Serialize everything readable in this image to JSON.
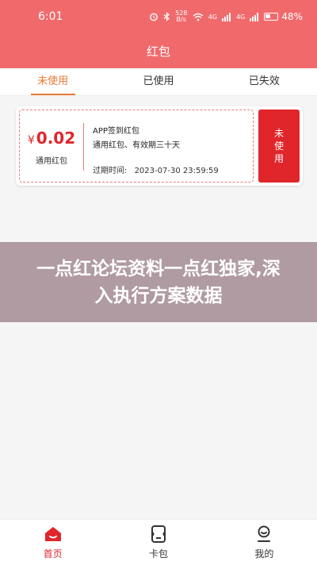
{
  "status_bar": {
    "time": "6:01",
    "net_speed": "528 B/s",
    "signal1": "4G",
    "signal2": "4G",
    "battery": "48%",
    "battery_level": 0.48
  },
  "header": {
    "title": "红包"
  },
  "tabs": [
    {
      "label": "未使用",
      "active": true
    },
    {
      "label": "已使用",
      "active": false
    },
    {
      "label": "已失效",
      "active": false
    }
  ],
  "coupon": {
    "currency": "¥",
    "amount": "0.02",
    "type_label": "通用红包",
    "name": "APP签到红包",
    "description": "通用红包、有效期三十天",
    "expiry_label": "过期时间:",
    "expiry_value": "2023-07-30 23:59:59",
    "status": "未使用"
  },
  "overlay": {
    "text": "一点红论坛资料一点红独家,深入执行方案数据"
  },
  "bottom_nav": [
    {
      "label": "首页",
      "icon": "home-icon",
      "active": true
    },
    {
      "label": "卡包",
      "icon": "card-wallet-icon",
      "active": false
    },
    {
      "label": "我的",
      "icon": "profile-icon",
      "active": false
    }
  ],
  "colors": {
    "header": "#f06a6c",
    "accent": "#e0262a",
    "tab_active": "#e87a35"
  }
}
